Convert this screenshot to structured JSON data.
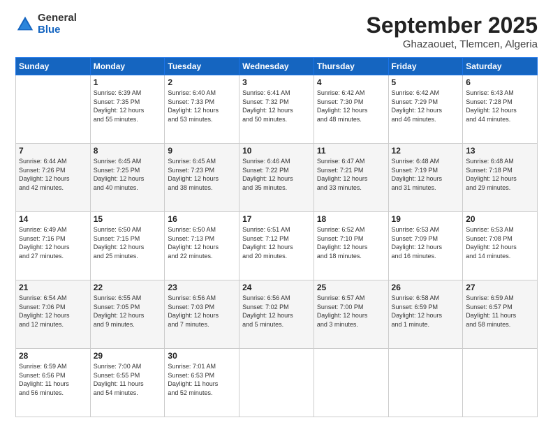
{
  "header": {
    "logo_general": "General",
    "logo_blue": "Blue",
    "month_title": "September 2025",
    "subtitle": "Ghazaouet, Tlemcen, Algeria"
  },
  "days_of_week": [
    "Sunday",
    "Monday",
    "Tuesday",
    "Wednesday",
    "Thursday",
    "Friday",
    "Saturday"
  ],
  "weeks": [
    [
      {
        "day": "",
        "info": ""
      },
      {
        "day": "1",
        "info": "Sunrise: 6:39 AM\nSunset: 7:35 PM\nDaylight: 12 hours\nand 55 minutes."
      },
      {
        "day": "2",
        "info": "Sunrise: 6:40 AM\nSunset: 7:33 PM\nDaylight: 12 hours\nand 53 minutes."
      },
      {
        "day": "3",
        "info": "Sunrise: 6:41 AM\nSunset: 7:32 PM\nDaylight: 12 hours\nand 50 minutes."
      },
      {
        "day": "4",
        "info": "Sunrise: 6:42 AM\nSunset: 7:30 PM\nDaylight: 12 hours\nand 48 minutes."
      },
      {
        "day": "5",
        "info": "Sunrise: 6:42 AM\nSunset: 7:29 PM\nDaylight: 12 hours\nand 46 minutes."
      },
      {
        "day": "6",
        "info": "Sunrise: 6:43 AM\nSunset: 7:28 PM\nDaylight: 12 hours\nand 44 minutes."
      }
    ],
    [
      {
        "day": "7",
        "info": "Sunrise: 6:44 AM\nSunset: 7:26 PM\nDaylight: 12 hours\nand 42 minutes."
      },
      {
        "day": "8",
        "info": "Sunrise: 6:45 AM\nSunset: 7:25 PM\nDaylight: 12 hours\nand 40 minutes."
      },
      {
        "day": "9",
        "info": "Sunrise: 6:45 AM\nSunset: 7:23 PM\nDaylight: 12 hours\nand 38 minutes."
      },
      {
        "day": "10",
        "info": "Sunrise: 6:46 AM\nSunset: 7:22 PM\nDaylight: 12 hours\nand 35 minutes."
      },
      {
        "day": "11",
        "info": "Sunrise: 6:47 AM\nSunset: 7:21 PM\nDaylight: 12 hours\nand 33 minutes."
      },
      {
        "day": "12",
        "info": "Sunrise: 6:48 AM\nSunset: 7:19 PM\nDaylight: 12 hours\nand 31 minutes."
      },
      {
        "day": "13",
        "info": "Sunrise: 6:48 AM\nSunset: 7:18 PM\nDaylight: 12 hours\nand 29 minutes."
      }
    ],
    [
      {
        "day": "14",
        "info": "Sunrise: 6:49 AM\nSunset: 7:16 PM\nDaylight: 12 hours\nand 27 minutes."
      },
      {
        "day": "15",
        "info": "Sunrise: 6:50 AM\nSunset: 7:15 PM\nDaylight: 12 hours\nand 25 minutes."
      },
      {
        "day": "16",
        "info": "Sunrise: 6:50 AM\nSunset: 7:13 PM\nDaylight: 12 hours\nand 22 minutes."
      },
      {
        "day": "17",
        "info": "Sunrise: 6:51 AM\nSunset: 7:12 PM\nDaylight: 12 hours\nand 20 minutes."
      },
      {
        "day": "18",
        "info": "Sunrise: 6:52 AM\nSunset: 7:10 PM\nDaylight: 12 hours\nand 18 minutes."
      },
      {
        "day": "19",
        "info": "Sunrise: 6:53 AM\nSunset: 7:09 PM\nDaylight: 12 hours\nand 16 minutes."
      },
      {
        "day": "20",
        "info": "Sunrise: 6:53 AM\nSunset: 7:08 PM\nDaylight: 12 hours\nand 14 minutes."
      }
    ],
    [
      {
        "day": "21",
        "info": "Sunrise: 6:54 AM\nSunset: 7:06 PM\nDaylight: 12 hours\nand 12 minutes."
      },
      {
        "day": "22",
        "info": "Sunrise: 6:55 AM\nSunset: 7:05 PM\nDaylight: 12 hours\nand 9 minutes."
      },
      {
        "day": "23",
        "info": "Sunrise: 6:56 AM\nSunset: 7:03 PM\nDaylight: 12 hours\nand 7 minutes."
      },
      {
        "day": "24",
        "info": "Sunrise: 6:56 AM\nSunset: 7:02 PM\nDaylight: 12 hours\nand 5 minutes."
      },
      {
        "day": "25",
        "info": "Sunrise: 6:57 AM\nSunset: 7:00 PM\nDaylight: 12 hours\nand 3 minutes."
      },
      {
        "day": "26",
        "info": "Sunrise: 6:58 AM\nSunset: 6:59 PM\nDaylight: 12 hours\nand 1 minute."
      },
      {
        "day": "27",
        "info": "Sunrise: 6:59 AM\nSunset: 6:57 PM\nDaylight: 11 hours\nand 58 minutes."
      }
    ],
    [
      {
        "day": "28",
        "info": "Sunrise: 6:59 AM\nSunset: 6:56 PM\nDaylight: 11 hours\nand 56 minutes."
      },
      {
        "day": "29",
        "info": "Sunrise: 7:00 AM\nSunset: 6:55 PM\nDaylight: 11 hours\nand 54 minutes."
      },
      {
        "day": "30",
        "info": "Sunrise: 7:01 AM\nSunset: 6:53 PM\nDaylight: 11 hours\nand 52 minutes."
      },
      {
        "day": "",
        "info": ""
      },
      {
        "day": "",
        "info": ""
      },
      {
        "day": "",
        "info": ""
      },
      {
        "day": "",
        "info": ""
      }
    ]
  ]
}
